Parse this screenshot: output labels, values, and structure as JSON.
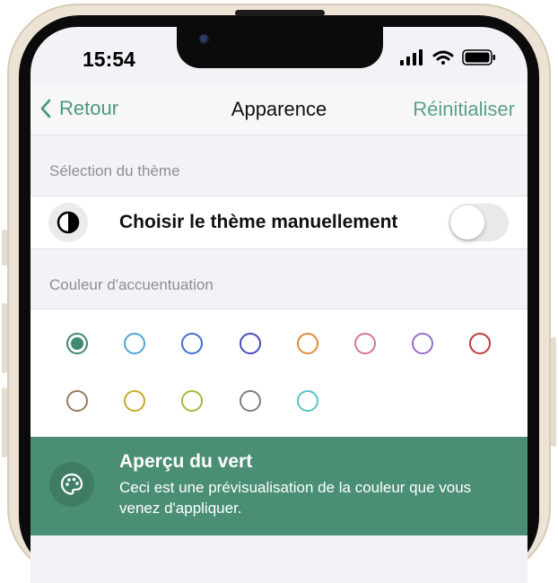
{
  "status_bar": {
    "time": "15:54"
  },
  "nav": {
    "back_label": "Retour",
    "title": "Apparence",
    "reset_label": "Réinitialiser"
  },
  "theme_section": {
    "header": "Sélection du thème",
    "manual_label": "Choisir le thème manuellement",
    "manual_enabled": false
  },
  "accent_section": {
    "header": "Couleur d'accuentuation",
    "colors": [
      {
        "name": "green",
        "hex": "#3f8a6c",
        "selected": true
      },
      {
        "name": "light-blue",
        "hex": "#4ea6d8",
        "selected": false
      },
      {
        "name": "blue",
        "hex": "#3e6fd0",
        "selected": false
      },
      {
        "name": "indigo",
        "hex": "#4b4bb8",
        "selected": false
      },
      {
        "name": "orange",
        "hex": "#e08a3a",
        "selected": false
      },
      {
        "name": "pink",
        "hex": "#d4739a",
        "selected": false
      },
      {
        "name": "purple",
        "hex": "#9a6bcf",
        "selected": false
      },
      {
        "name": "red",
        "hex": "#bf3a3a",
        "selected": false
      },
      {
        "name": "brown",
        "hex": "#9a7a5a",
        "selected": false
      },
      {
        "name": "yellow",
        "hex": "#c8aa2a",
        "selected": false
      },
      {
        "name": "lime",
        "hex": "#a8b83a",
        "selected": false
      },
      {
        "name": "gray",
        "hex": "#7f7f7f",
        "selected": false
      },
      {
        "name": "teal",
        "hex": "#56c2c8",
        "selected": false
      }
    ]
  },
  "preview": {
    "title": "Aperçu du vert",
    "description": "Ceci est une prévisualisation de la couleur que vous venez d'appliquer."
  }
}
